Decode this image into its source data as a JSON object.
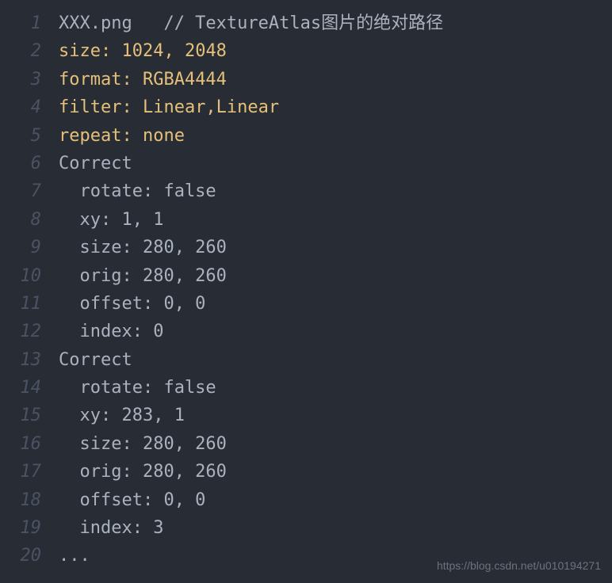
{
  "lines": [
    {
      "num": "1",
      "segments": [
        {
          "cls": "plain",
          "text": "XXX.png   // TextureAtlas图片的绝对路径"
        }
      ]
    },
    {
      "num": "2",
      "segments": [
        {
          "cls": "highlight",
          "text": "size:"
        },
        {
          "cls": "highlight",
          "text": " 1024, 2048"
        }
      ]
    },
    {
      "num": "3",
      "segments": [
        {
          "cls": "highlight",
          "text": "format:"
        },
        {
          "cls": "highlight",
          "text": " RGBA4444"
        }
      ]
    },
    {
      "num": "4",
      "segments": [
        {
          "cls": "highlight",
          "text": "filter:"
        },
        {
          "cls": "highlight",
          "text": " Linear,Linear"
        }
      ]
    },
    {
      "num": "5",
      "segments": [
        {
          "cls": "highlight",
          "text": "repeat:"
        },
        {
          "cls": "highlight",
          "text": " none"
        }
      ]
    },
    {
      "num": "6",
      "segments": [
        {
          "cls": "plain",
          "text": "Correct"
        }
      ]
    },
    {
      "num": "7",
      "segments": [
        {
          "cls": "plain",
          "text": "  rotate: false"
        }
      ]
    },
    {
      "num": "8",
      "segments": [
        {
          "cls": "plain",
          "text": "  xy: 1, 1"
        }
      ]
    },
    {
      "num": "9",
      "segments": [
        {
          "cls": "plain",
          "text": "  size: 280, 260"
        }
      ]
    },
    {
      "num": "10",
      "segments": [
        {
          "cls": "plain",
          "text": "  orig: 280, 260"
        }
      ]
    },
    {
      "num": "11",
      "segments": [
        {
          "cls": "plain",
          "text": "  offset: 0, 0"
        }
      ]
    },
    {
      "num": "12",
      "segments": [
        {
          "cls": "plain",
          "text": "  index: 0"
        }
      ]
    },
    {
      "num": "13",
      "segments": [
        {
          "cls": "plain",
          "text": "Correct"
        }
      ]
    },
    {
      "num": "14",
      "segments": [
        {
          "cls": "plain",
          "text": "  rotate: false"
        }
      ]
    },
    {
      "num": "15",
      "segments": [
        {
          "cls": "plain",
          "text": "  xy: 283, 1"
        }
      ]
    },
    {
      "num": "16",
      "segments": [
        {
          "cls": "plain",
          "text": "  size: 280, 260"
        }
      ]
    },
    {
      "num": "17",
      "segments": [
        {
          "cls": "plain",
          "text": "  orig: 280, 260"
        }
      ]
    },
    {
      "num": "18",
      "segments": [
        {
          "cls": "plain",
          "text": "  offset: 0, 0"
        }
      ]
    },
    {
      "num": "19",
      "segments": [
        {
          "cls": "plain",
          "text": "  index: 3"
        }
      ]
    },
    {
      "num": "20",
      "segments": [
        {
          "cls": "plain",
          "text": "..."
        }
      ]
    }
  ],
  "watermark": "https://blog.csdn.net/u010194271"
}
